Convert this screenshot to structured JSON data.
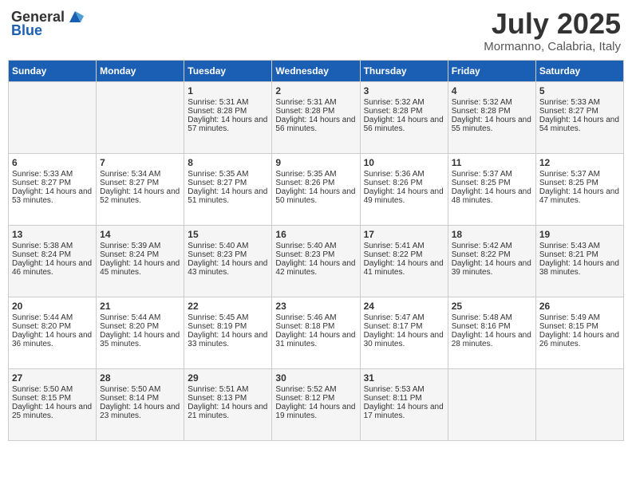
{
  "header": {
    "logo_general": "General",
    "logo_blue": "Blue",
    "month_year": "July 2025",
    "location": "Mormanno, Calabria, Italy"
  },
  "weekdays": [
    "Sunday",
    "Monday",
    "Tuesday",
    "Wednesday",
    "Thursday",
    "Friday",
    "Saturday"
  ],
  "weeks": [
    [
      {
        "day": "",
        "sunrise": "",
        "sunset": "",
        "daylight": ""
      },
      {
        "day": "",
        "sunrise": "",
        "sunset": "",
        "daylight": ""
      },
      {
        "day": "1",
        "sunrise": "Sunrise: 5:31 AM",
        "sunset": "Sunset: 8:28 PM",
        "daylight": "Daylight: 14 hours and 57 minutes."
      },
      {
        "day": "2",
        "sunrise": "Sunrise: 5:31 AM",
        "sunset": "Sunset: 8:28 PM",
        "daylight": "Daylight: 14 hours and 56 minutes."
      },
      {
        "day": "3",
        "sunrise": "Sunrise: 5:32 AM",
        "sunset": "Sunset: 8:28 PM",
        "daylight": "Daylight: 14 hours and 56 minutes."
      },
      {
        "day": "4",
        "sunrise": "Sunrise: 5:32 AM",
        "sunset": "Sunset: 8:28 PM",
        "daylight": "Daylight: 14 hours and 55 minutes."
      },
      {
        "day": "5",
        "sunrise": "Sunrise: 5:33 AM",
        "sunset": "Sunset: 8:27 PM",
        "daylight": "Daylight: 14 hours and 54 minutes."
      }
    ],
    [
      {
        "day": "6",
        "sunrise": "Sunrise: 5:33 AM",
        "sunset": "Sunset: 8:27 PM",
        "daylight": "Daylight: 14 hours and 53 minutes."
      },
      {
        "day": "7",
        "sunrise": "Sunrise: 5:34 AM",
        "sunset": "Sunset: 8:27 PM",
        "daylight": "Daylight: 14 hours and 52 minutes."
      },
      {
        "day": "8",
        "sunrise": "Sunrise: 5:35 AM",
        "sunset": "Sunset: 8:27 PM",
        "daylight": "Daylight: 14 hours and 51 minutes."
      },
      {
        "day": "9",
        "sunrise": "Sunrise: 5:35 AM",
        "sunset": "Sunset: 8:26 PM",
        "daylight": "Daylight: 14 hours and 50 minutes."
      },
      {
        "day": "10",
        "sunrise": "Sunrise: 5:36 AM",
        "sunset": "Sunset: 8:26 PM",
        "daylight": "Daylight: 14 hours and 49 minutes."
      },
      {
        "day": "11",
        "sunrise": "Sunrise: 5:37 AM",
        "sunset": "Sunset: 8:25 PM",
        "daylight": "Daylight: 14 hours and 48 minutes."
      },
      {
        "day": "12",
        "sunrise": "Sunrise: 5:37 AM",
        "sunset": "Sunset: 8:25 PM",
        "daylight": "Daylight: 14 hours and 47 minutes."
      }
    ],
    [
      {
        "day": "13",
        "sunrise": "Sunrise: 5:38 AM",
        "sunset": "Sunset: 8:24 PM",
        "daylight": "Daylight: 14 hours and 46 minutes."
      },
      {
        "day": "14",
        "sunrise": "Sunrise: 5:39 AM",
        "sunset": "Sunset: 8:24 PM",
        "daylight": "Daylight: 14 hours and 45 minutes."
      },
      {
        "day": "15",
        "sunrise": "Sunrise: 5:40 AM",
        "sunset": "Sunset: 8:23 PM",
        "daylight": "Daylight: 14 hours and 43 minutes."
      },
      {
        "day": "16",
        "sunrise": "Sunrise: 5:40 AM",
        "sunset": "Sunset: 8:23 PM",
        "daylight": "Daylight: 14 hours and 42 minutes."
      },
      {
        "day": "17",
        "sunrise": "Sunrise: 5:41 AM",
        "sunset": "Sunset: 8:22 PM",
        "daylight": "Daylight: 14 hours and 41 minutes."
      },
      {
        "day": "18",
        "sunrise": "Sunrise: 5:42 AM",
        "sunset": "Sunset: 8:22 PM",
        "daylight": "Daylight: 14 hours and 39 minutes."
      },
      {
        "day": "19",
        "sunrise": "Sunrise: 5:43 AM",
        "sunset": "Sunset: 8:21 PM",
        "daylight": "Daylight: 14 hours and 38 minutes."
      }
    ],
    [
      {
        "day": "20",
        "sunrise": "Sunrise: 5:44 AM",
        "sunset": "Sunset: 8:20 PM",
        "daylight": "Daylight: 14 hours and 36 minutes."
      },
      {
        "day": "21",
        "sunrise": "Sunrise: 5:44 AM",
        "sunset": "Sunset: 8:20 PM",
        "daylight": "Daylight: 14 hours and 35 minutes."
      },
      {
        "day": "22",
        "sunrise": "Sunrise: 5:45 AM",
        "sunset": "Sunset: 8:19 PM",
        "daylight": "Daylight: 14 hours and 33 minutes."
      },
      {
        "day": "23",
        "sunrise": "Sunrise: 5:46 AM",
        "sunset": "Sunset: 8:18 PM",
        "daylight": "Daylight: 14 hours and 31 minutes."
      },
      {
        "day": "24",
        "sunrise": "Sunrise: 5:47 AM",
        "sunset": "Sunset: 8:17 PM",
        "daylight": "Daylight: 14 hours and 30 minutes."
      },
      {
        "day": "25",
        "sunrise": "Sunrise: 5:48 AM",
        "sunset": "Sunset: 8:16 PM",
        "daylight": "Daylight: 14 hours and 28 minutes."
      },
      {
        "day": "26",
        "sunrise": "Sunrise: 5:49 AM",
        "sunset": "Sunset: 8:15 PM",
        "daylight": "Daylight: 14 hours and 26 minutes."
      }
    ],
    [
      {
        "day": "27",
        "sunrise": "Sunrise: 5:50 AM",
        "sunset": "Sunset: 8:15 PM",
        "daylight": "Daylight: 14 hours and 25 minutes."
      },
      {
        "day": "28",
        "sunrise": "Sunrise: 5:50 AM",
        "sunset": "Sunset: 8:14 PM",
        "daylight": "Daylight: 14 hours and 23 minutes."
      },
      {
        "day": "29",
        "sunrise": "Sunrise: 5:51 AM",
        "sunset": "Sunset: 8:13 PM",
        "daylight": "Daylight: 14 hours and 21 minutes."
      },
      {
        "day": "30",
        "sunrise": "Sunrise: 5:52 AM",
        "sunset": "Sunset: 8:12 PM",
        "daylight": "Daylight: 14 hours and 19 minutes."
      },
      {
        "day": "31",
        "sunrise": "Sunrise: 5:53 AM",
        "sunset": "Sunset: 8:11 PM",
        "daylight": "Daylight: 14 hours and 17 minutes."
      },
      {
        "day": "",
        "sunrise": "",
        "sunset": "",
        "daylight": ""
      },
      {
        "day": "",
        "sunrise": "",
        "sunset": "",
        "daylight": ""
      }
    ]
  ]
}
